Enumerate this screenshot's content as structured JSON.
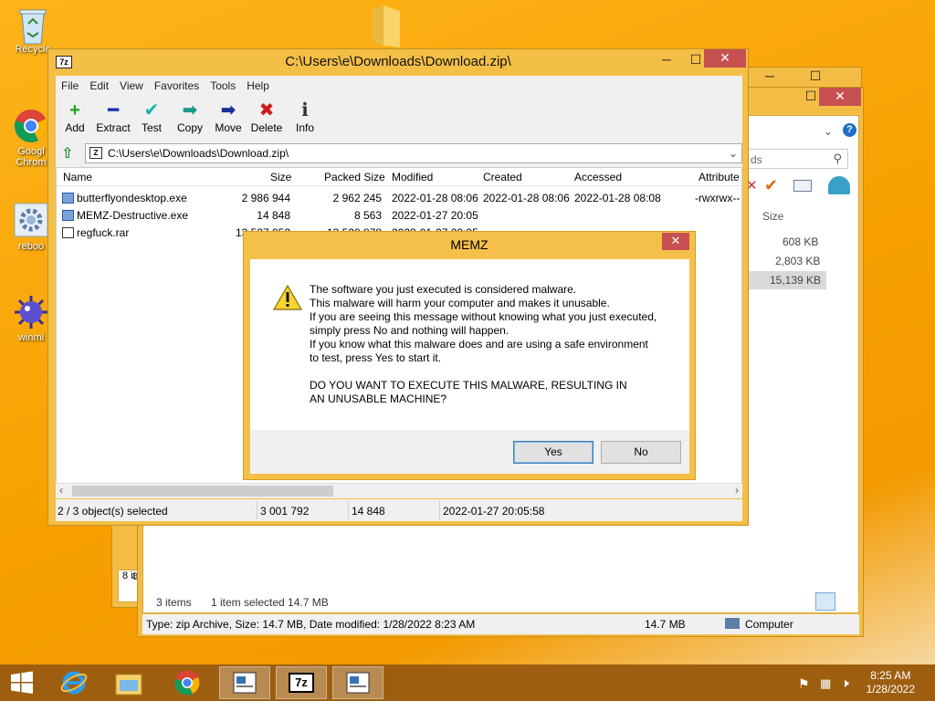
{
  "desktop": {
    "icons": [
      {
        "label": "Recycle"
      },
      {
        "label": "Googl Chrom"
      },
      {
        "label": "reboo"
      },
      {
        "label": "winmi"
      }
    ]
  },
  "explorer_back": {
    "search_placeholder": "ds",
    "size_header": "Size",
    "sizes": [
      "608 KB",
      "2,803 KB",
      "15,139 KB"
    ],
    "items_count": "3 items",
    "selection": "1 item selected  14.7 MB",
    "side_count": "8 it",
    "side_num": "8",
    "status_type": "Type: zip Archive, Size: 14.7 MB, Date modified: 1/28/2022 8:23 AM",
    "status_size": "14.7 MB",
    "status_location": "Computer"
  },
  "zip": {
    "title": "C:\\Users\\e\\Downloads\\Download.zip\\",
    "logo": "7z",
    "menu": [
      "File",
      "Edit",
      "View",
      "Favorites",
      "Tools",
      "Help"
    ],
    "toolbar": [
      {
        "label": "Add",
        "icon": "add-icon",
        "glyph": "+",
        "color": "#1fa31f"
      },
      {
        "label": "Extract",
        "icon": "extract-icon",
        "glyph": "━",
        "color": "#1a2fb0"
      },
      {
        "label": "Test",
        "icon": "test-icon",
        "glyph": "✔",
        "color": "#1ab0b0"
      },
      {
        "label": "Copy",
        "icon": "copy-icon",
        "glyph": "➡",
        "color": "#1a9a8a"
      },
      {
        "label": "Move",
        "icon": "move-icon",
        "glyph": "➡",
        "color": "#1a2f9a"
      },
      {
        "label": "Delete",
        "icon": "delete-icon",
        "glyph": "✖",
        "color": "#d01a1a"
      },
      {
        "label": "Info",
        "icon": "info-icon",
        "glyph": "ℹ",
        "color": "#333333"
      }
    ],
    "address": "C:\\Users\\e\\Downloads\\Download.zip\\",
    "columns": [
      "Name",
      "Size",
      "Packed Size",
      "Modified",
      "Created",
      "Accessed",
      "Attribute"
    ],
    "files": [
      {
        "name": "butterflyondesktop.exe",
        "size": "2 986 944",
        "packed": "2 962 245",
        "modified": "2022-01-28 08:06",
        "created": "2022-01-28 08:06",
        "accessed": "2022-01-28 08:08",
        "attr": "-rwxrwx--"
      },
      {
        "name": "MEMZ-Destructive.exe",
        "size": "14 848",
        "packed": "8 563",
        "modified": "2022-01-27 20:05",
        "created": "",
        "accessed": "",
        "attr": ""
      },
      {
        "name": "regfuck.rar",
        "size": "13 537 052",
        "packed": "13 520 878",
        "modified": "2022-01-27 20:05",
        "created": "",
        "accessed": "",
        "attr": ""
      }
    ],
    "status": {
      "selected": "2 / 3 object(s) selected",
      "total": "3 001 792",
      "packed": "14 848",
      "date": "2022-01-27 20:05:58"
    }
  },
  "dialog": {
    "title": "MEMZ",
    "lines": [
      "The software you just executed is considered malware.",
      "This malware will harm your computer and makes it unusable.",
      "If you are seeing this message without knowing what you just executed,",
      "simply press No and nothing will happen.",
      "If you know what this malware does and are using a safe environment",
      "to test, press Yes to start it."
    ],
    "question": "DO YOU WANT TO EXECUTE THIS MALWARE, RESULTING IN AN UNUSABLE MACHINE?",
    "yes": "Yes",
    "no": "No"
  },
  "taskbar": {
    "time": "8:25 AM",
    "date": "1/28/2022",
    "sevenz": "7z"
  }
}
